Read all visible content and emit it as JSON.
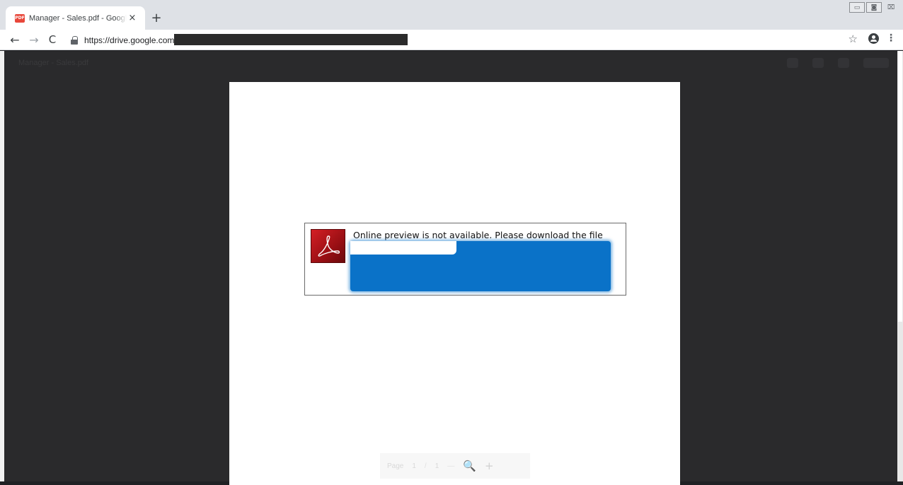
{
  "browser": {
    "tab": {
      "favicon_text": "PDF",
      "title": "Manager - Sales.pdf - Google Drive",
      "close_glyph": "×"
    },
    "new_tab_glyph": "+",
    "window_controls": {
      "minimize": "▭",
      "maximize": "◙",
      "close": "⌧"
    },
    "toolbar": {
      "back_glyph": "←",
      "forward_glyph": "→",
      "reload_glyph": "C",
      "url": "https://drive.google.com/",
      "bookmark_glyph": "☆",
      "menu_glyph": "⋮"
    }
  },
  "viewer": {
    "header_filename": "Manager - Sales.pdf",
    "notice": {
      "message": "Online preview is not available. Please download the file from the original source:"
    },
    "page_controls": {
      "page_label": "Page",
      "current_page": "1",
      "separator": "/",
      "total_pages": "1",
      "zoom_out": "—",
      "zoom_glyph": "🔍",
      "zoom_in": "+"
    }
  },
  "colors": {
    "viewer_bg": "#2a2a2c",
    "tabstrip_bg": "#dee1e6",
    "acrobat_red": "#d42025",
    "redaction_blue": "#0a72c8"
  }
}
